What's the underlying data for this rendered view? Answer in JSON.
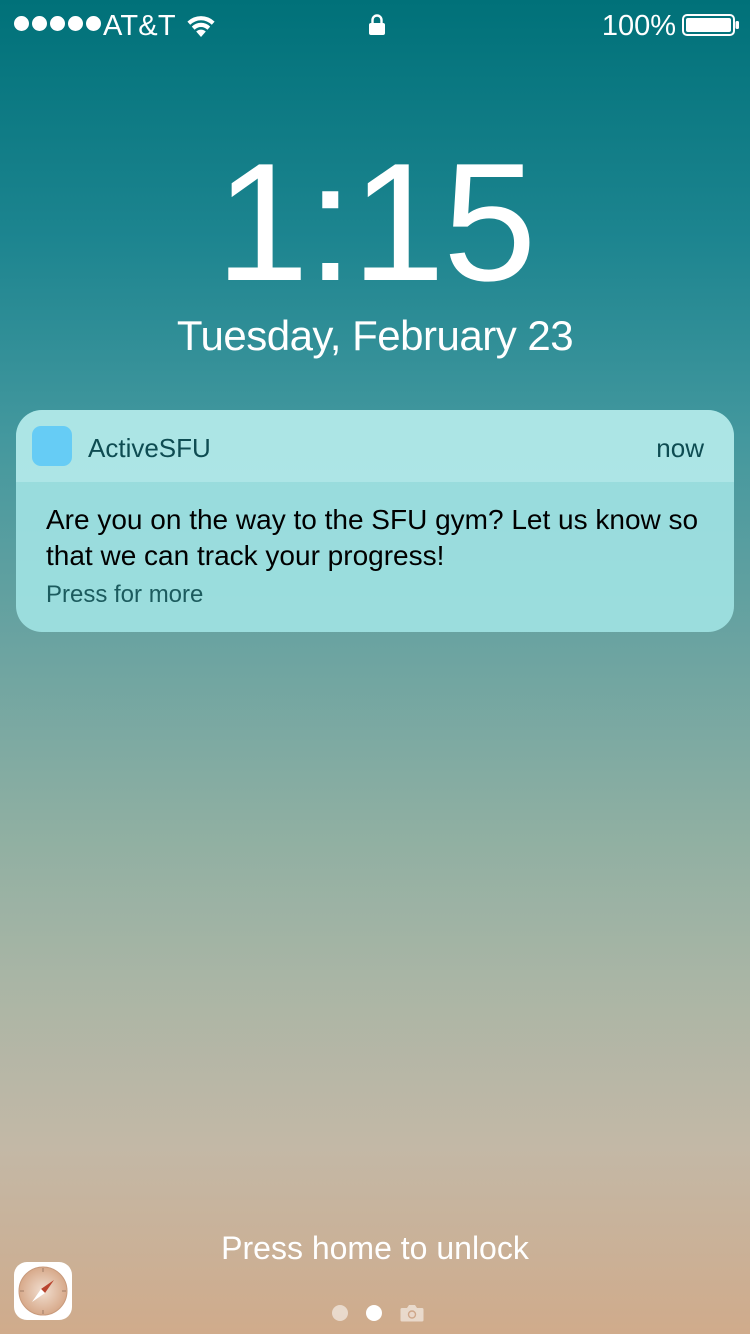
{
  "status_bar": {
    "signal_bars": 5,
    "carrier": "AT&T",
    "wifi_icon": "wifi-icon",
    "lock_icon": "lock-icon",
    "battery_percent": "100%",
    "battery_level": 1.0
  },
  "lock_screen": {
    "time": "1:15",
    "date": "Tuesday, February 23"
  },
  "notification": {
    "app_name": "ActiveSFU",
    "time": "now",
    "message": "Are you on the way to the SFU gym? Let us know so that we can track your progress!",
    "more_hint": "Press for more",
    "app_icon_color": "#66ccf5"
  },
  "footer": {
    "unlock_hint": "Press home to unlock",
    "suggested_app_icon": "safari-icon",
    "pages": 2,
    "active_page": 2,
    "camera_icon": "camera-icon"
  }
}
